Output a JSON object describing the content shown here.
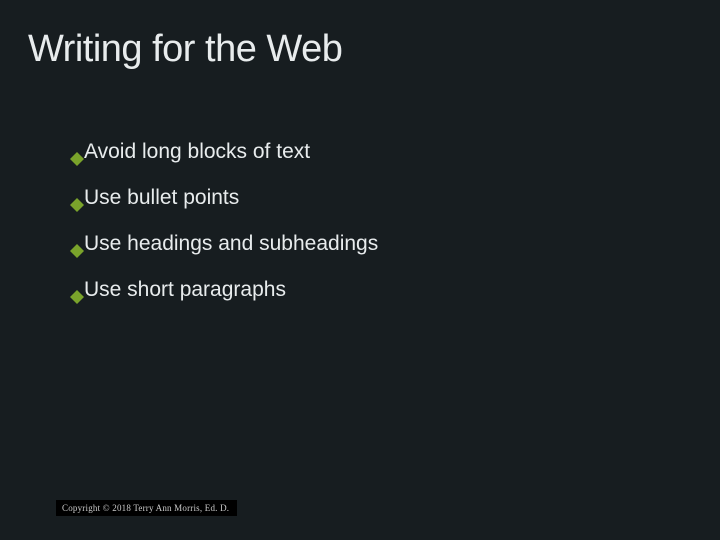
{
  "title": "Writing for the Web",
  "bullets": {
    "b0": "Avoid long blocks of text",
    "b1": "Use bullet points",
    "b2": "Use headings and subheadings",
    "b3": "Use short paragraphs"
  },
  "footer": "Copyright © 2018 Terry Ann Morris, Ed. D.",
  "colors": {
    "background": "#171d20",
    "text": "#e8eced",
    "bullet": "#7aa32b"
  }
}
